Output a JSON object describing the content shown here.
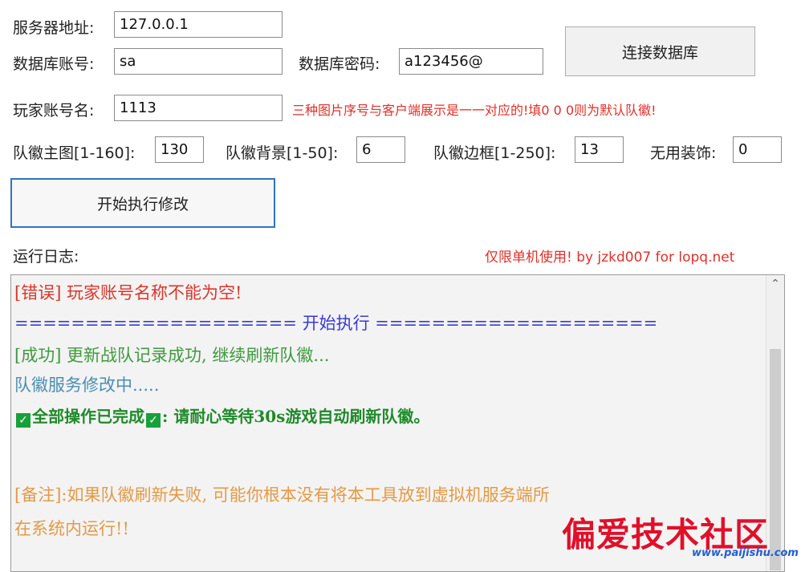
{
  "form": {
    "server_label": "服务器地址:",
    "server_value": "127.0.0.1",
    "db_user_label": "数据库账号:",
    "db_user_value": "sa",
    "db_pass_label": "数据库密码:",
    "db_pass_value": "a123456@",
    "connect_button": "连接数据库",
    "player_label": "玩家账号名:",
    "player_value": "1113",
    "player_note": "三种图片序号与客户端展示是一一对应的!填0 0 0则为默认队徽!",
    "emblem_main_label": "队徽主图[1-160]:",
    "emblem_main_value": "130",
    "emblem_bg_label": "队徽背景[1-50]:",
    "emblem_bg_value": "6",
    "emblem_border_label": "队徽边框[1-250]:",
    "emblem_border_value": "13",
    "unused_label": "无用装饰:",
    "unused_value": "0",
    "start_button": "开始执行修改"
  },
  "log": {
    "label": "运行日志:",
    "credit": "仅限单机使用! by jzkd007 for lopq.net",
    "lines": {
      "error": "[错误] 玩家账号名称不能为空!",
      "separator": "==================== 开始执行 ====================",
      "success": "[成功] 更新战队记录成功, 继续刷新队徽...",
      "progress": "队徽服务修改中.....",
      "done_a": "全部操作已完成",
      "done_b": ": 请耐心等待30s游戏自动刷新队徽。",
      "remark_1": "[备注]:如果队徽刷新失败, 可能你根本没有将本工具放到虚拟机服务端所",
      "remark_2": "在系统内运行!!"
    },
    "check_glyph": "✓",
    "scroll_up_glyph": "⌃"
  },
  "watermark": {
    "text": "偏爱技术社区",
    "url": "www.paijishu.com"
  },
  "colors": {
    "error": "#d9362b",
    "separator": "#3a3ad8",
    "success": "#3f9a3f",
    "progress": "#4a8fb0",
    "done": "#1f8a2a",
    "remark": "#e39a45",
    "accent": "#2f74c0"
  }
}
